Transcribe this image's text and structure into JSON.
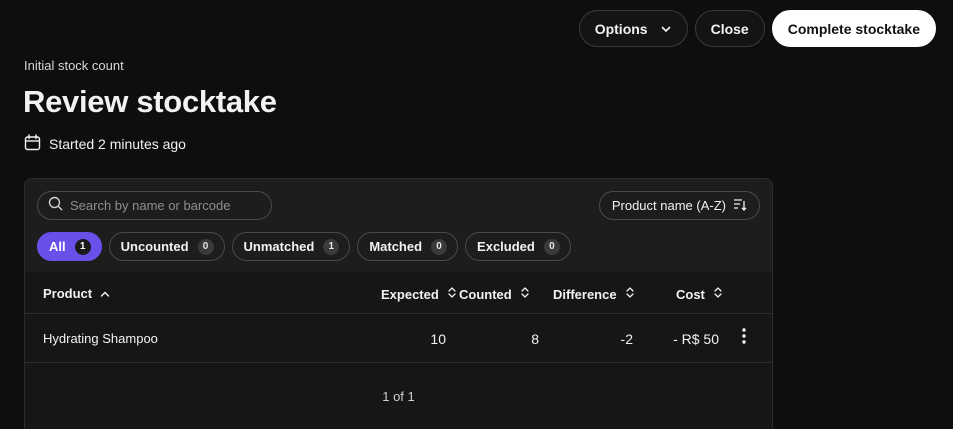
{
  "toolbar": {
    "options_label": "Options",
    "close_label": "Close",
    "complete_label": "Complete stocktake"
  },
  "header": {
    "subtitle": "Initial stock count",
    "title": "Review stocktake",
    "started": "Started 2 minutes ago"
  },
  "search": {
    "placeholder": "Search by name or barcode"
  },
  "sort": {
    "label": "Product name (A-Z)"
  },
  "filters": [
    {
      "label": "All",
      "count": "1",
      "active": true
    },
    {
      "label": "Uncounted",
      "count": "0"
    },
    {
      "label": "Unmatched",
      "count": "1"
    },
    {
      "label": "Matched",
      "count": "0"
    },
    {
      "label": "Excluded",
      "count": "0"
    }
  ],
  "columns": {
    "product": "Product",
    "expected": "Expected",
    "counted": "Counted",
    "difference": "Difference",
    "cost": "Cost"
  },
  "rows": [
    {
      "product": "Hydrating Shampoo",
      "expected": "10",
      "counted": "8",
      "difference": "-2",
      "cost": "- R$ 50"
    }
  ],
  "pagination": "1 of 1",
  "colors": {
    "accent": "#6b4fe9",
    "background": "#0e0e0e",
    "panel": "#161616"
  }
}
